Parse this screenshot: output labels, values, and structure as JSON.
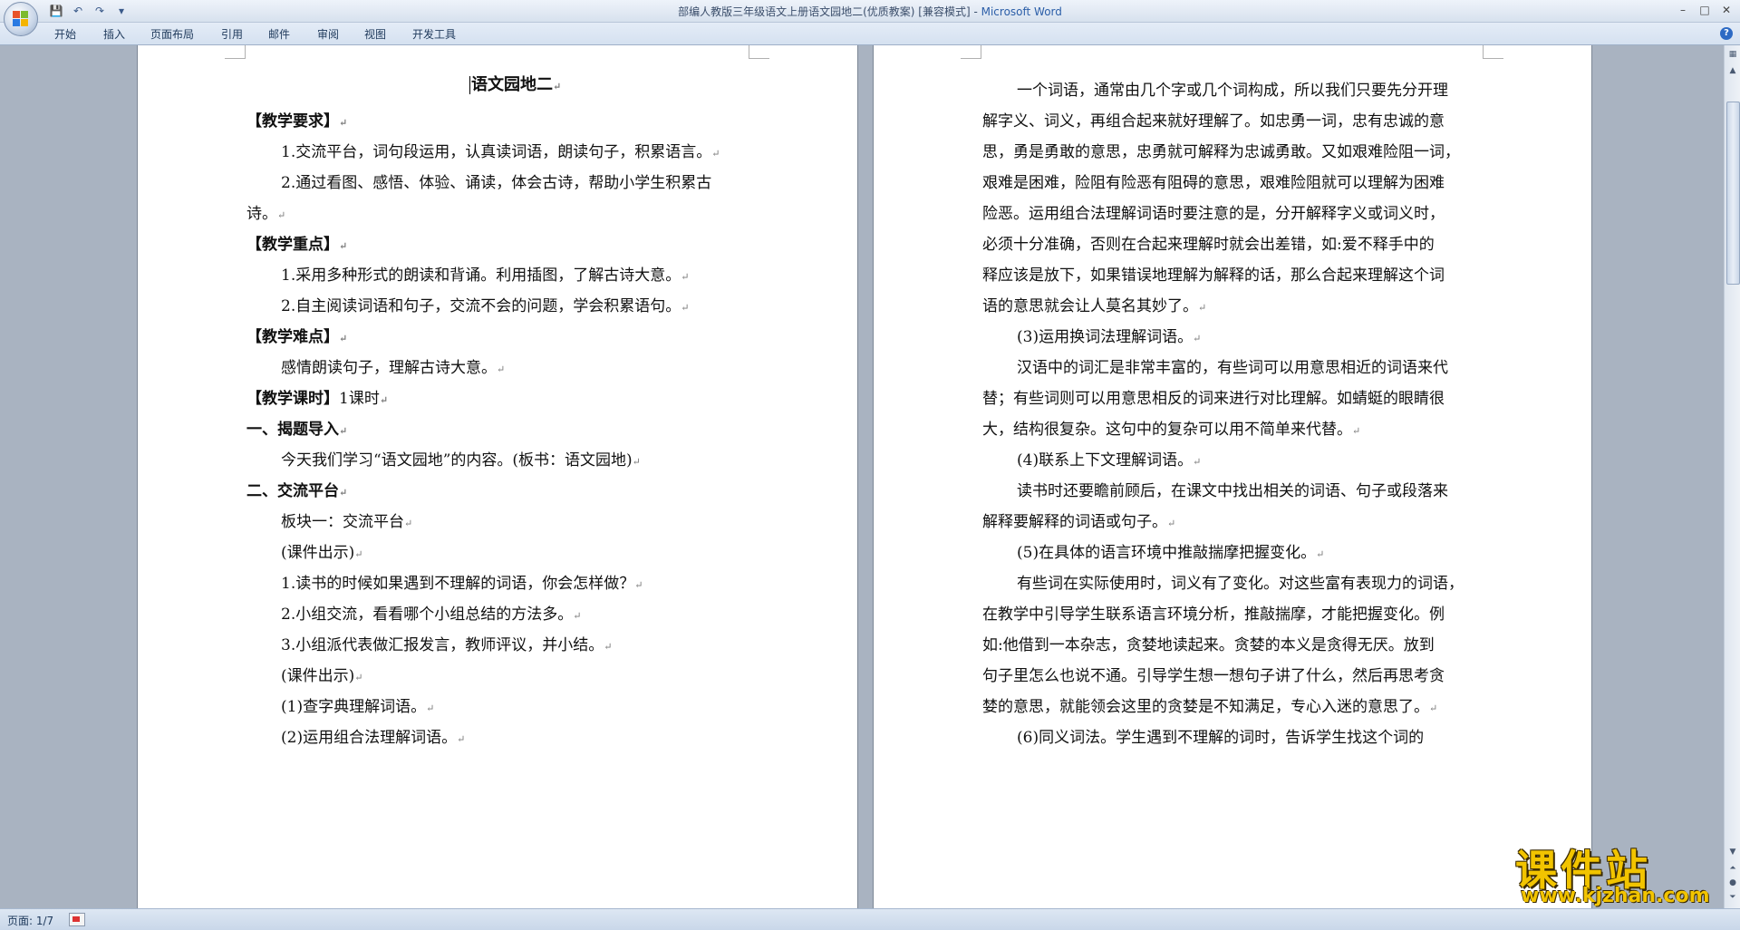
{
  "window": {
    "title": "部编人教版三年级语文上册语文园地二(优质教案) [兼容模式]",
    "title_sep": " - ",
    "app_name": "Microsoft Word",
    "controls": [
      "–",
      "□",
      "✕"
    ]
  },
  "quick_access": {
    "icons": [
      "save-icon",
      "undo-icon",
      "redo-icon",
      "customize-icon"
    ],
    "glyphs": [
      "💾",
      "↶",
      "↷",
      "▾"
    ]
  },
  "ribbon": {
    "tabs": [
      "开始",
      "插入",
      "页面布局",
      "引用",
      "邮件",
      "审阅",
      "视图",
      "开发工具"
    ],
    "help": "?"
  },
  "page1": {
    "title": "语文园地二",
    "lines": [
      {
        "text": "【教学要求】",
        "bold": true
      },
      {
        "text": "1.交流平台，词句段运用，认真读词语，朗读句子，积累语言。",
        "bold": false
      },
      {
        "text": "2.通过看图、感悟、体验、诵读，体会古诗，帮助小学生积累古",
        "bold": false,
        "nomark": true
      },
      {
        "text": "诗。",
        "bold": false
      },
      {
        "text": "【教学重点】",
        "bold": true
      },
      {
        "text": "1.采用多种形式的朗读和背诵。利用插图，了解古诗大意。",
        "bold": false
      },
      {
        "text": "2.自主阅读词语和句子，交流不会的问题，学会积累语句。",
        "bold": false
      },
      {
        "text": "【教学难点】",
        "bold": true
      },
      {
        "text": "感情朗读句子，理解古诗大意。",
        "bold": false
      },
      {
        "text": "【教学课时】",
        "bold": true,
        "suffix": "1课时"
      },
      {
        "text": "一、揭题导入",
        "bold": true
      },
      {
        "text": "今天我们学习“语文园地”的内容。(板书：语文园地)",
        "bold": false
      },
      {
        "text": "二、交流平台",
        "bold": true
      },
      {
        "text": "板块一：交流平台",
        "bold": false
      },
      {
        "text": "(课件出示)",
        "bold": false
      },
      {
        "text": "1.读书的时候如果遇到不理解的词语，你会怎样做？",
        "bold": false
      },
      {
        "text": "2.小组交流，看看哪个小组总结的方法多。",
        "bold": false
      },
      {
        "text": "3.小组派代表做汇报发言，教师评议，并小结。",
        "bold": false
      },
      {
        "text": "(课件出示)",
        "bold": false
      },
      {
        "text": "(1)查字典理解词语。",
        "bold": false
      },
      {
        "text": "(2)运用组合法理解词语。",
        "bold": false
      }
    ]
  },
  "page2": {
    "lines": [
      {
        "text": "一个词语，通常由几个字或几个词构成，所以我们只要先分开理",
        "nomark": true
      },
      {
        "text": "解字义、词义，再组合起来就好理解了。如忠勇一词，忠有忠诚的意",
        "nomark": true
      },
      {
        "text": "思，勇是勇敢的意思，忠勇就可解释为忠诚勇敢。又如艰难险阻一词，",
        "nomark": true
      },
      {
        "text": "艰难是困难，险阻有险恶有阻碍的意思，艰难险阻就可以理解为困难",
        "nomark": true
      },
      {
        "text": "险恶。运用组合法理解词语时要注意的是，分开解释字义或词义时，",
        "nomark": true
      },
      {
        "text": "必须十分准确，否则在合起来理解时就会出差错，如:爱不释手中的",
        "nomark": true
      },
      {
        "text": "释应该是放下，如果错误地理解为解释的话，那么合起来理解这个词",
        "nomark": true
      },
      {
        "text": "语的意思就会让人莫名其妙了。"
      },
      {
        "text": "(3)运用换词法理解词语。"
      },
      {
        "text": "汉语中的词汇是非常丰富的，有些词可以用意思相近的词语来代",
        "nomark": true
      },
      {
        "text": "替；有些词则可以用意思相反的词来进行对比理解。如蜻蜓的眼睛很",
        "nomark": true
      },
      {
        "text": "大，结构很复杂。这句中的复杂可以用不简单来代替。"
      },
      {
        "text": "(4)联系上下文理解词语。"
      },
      {
        "text": "读书时还要瞻前顾后，在课文中找出相关的词语、句子或段落来",
        "nomark": true
      },
      {
        "text": "解释要解释的词语或句子。"
      },
      {
        "text": "(5)在具体的语言环境中推敲揣摩把握变化。"
      },
      {
        "text": "有些词在实际使用时，词义有了变化。对这些富有表现力的词语，",
        "nomark": true
      },
      {
        "text": "在教学中引导学生联系语言环境分析，推敲揣摩，才能把握变化。例",
        "nomark": true
      },
      {
        "text": "如:他借到一本杂志，贪婪地读起来。贪婪的本义是贪得无厌。放到",
        "nomark": true
      },
      {
        "text": "句子里怎么也说不通。引导学生想一想句子讲了什么，然后再思考贪",
        "nomark": true
      },
      {
        "text": "婪的意思，就能领会这里的贪婪是不知满足，专心入迷的意思了。"
      },
      {
        "text": "(6)同义词法。学生遇到不理解的词时，告诉学生找这个词的",
        "nomark": true
      }
    ]
  },
  "paragraph_mark": "↵",
  "statusbar": {
    "page_info": "页面: 1/7"
  },
  "watermark": {
    "title": "课件站",
    "url": "www.kjzhan.com"
  }
}
